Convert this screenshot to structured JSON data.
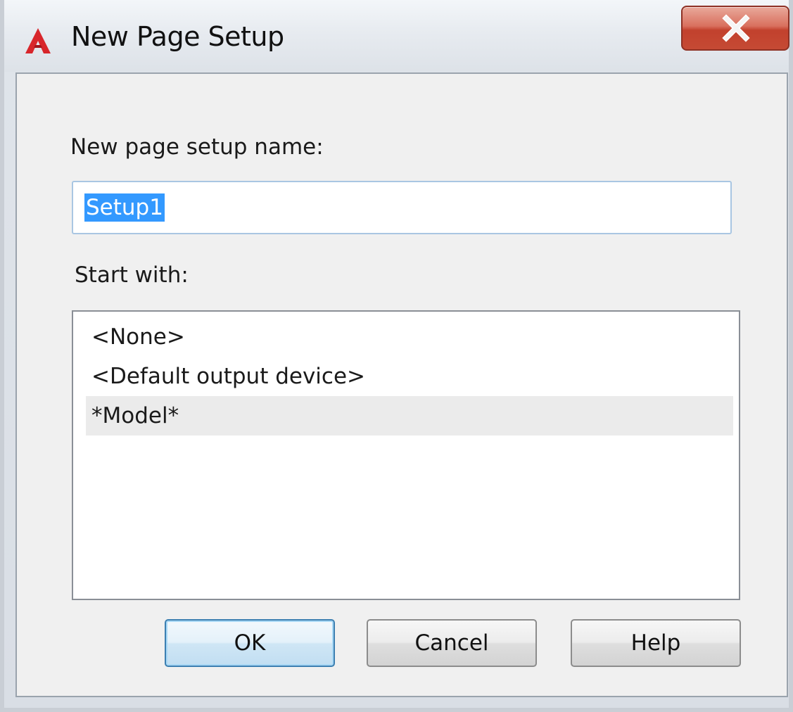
{
  "window": {
    "title": "New Page Setup",
    "app_icon": "autocad-logo-icon",
    "close_icon": "close-icon"
  },
  "form": {
    "name_label": "New page setup name:",
    "name_value": "Setup1",
    "start_with_label": "Start with:",
    "start_with_options": [
      "<None>",
      "<Default output device>",
      "*Model*"
    ]
  },
  "buttons": {
    "ok": "OK",
    "cancel": "Cancel",
    "help": "Help"
  },
  "colors": {
    "close_button": "#c7432f",
    "selection_highlight": "#3399ff",
    "default_button_border": "#3c7fb1",
    "app_icon_red": "#d8262b"
  }
}
